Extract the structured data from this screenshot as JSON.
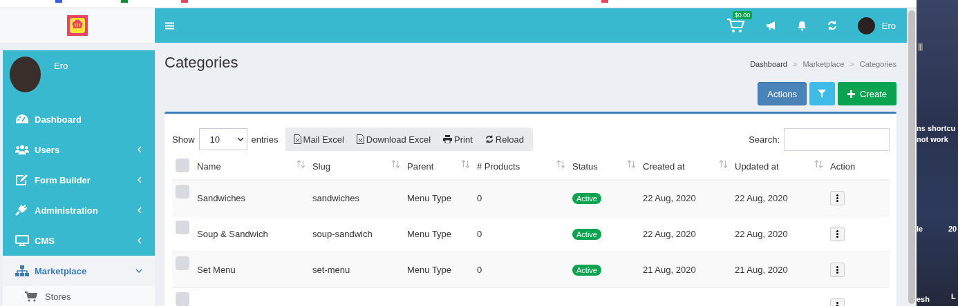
{
  "header": {
    "cart_total": "$0.00",
    "user": "Ero"
  },
  "sidebar": {
    "user": "Ero",
    "items": [
      {
        "label": "Dashboard",
        "expandable": false,
        "expanded": false,
        "selected": false
      },
      {
        "label": "Users",
        "expandable": true,
        "expanded": false,
        "selected": false
      },
      {
        "label": "Form Builder",
        "expandable": true,
        "expanded": false,
        "selected": false
      },
      {
        "label": "Administration",
        "expandable": true,
        "expanded": false,
        "selected": false
      },
      {
        "label": "CMS",
        "expandable": true,
        "expanded": false,
        "selected": false
      },
      {
        "label": "Marketplace",
        "expandable": true,
        "expanded": true,
        "selected": true,
        "children": [
          {
            "label": "Stores",
            "selected": false
          }
        ]
      }
    ]
  },
  "page": {
    "title": "Categories",
    "breadcrumb_separator": ">",
    "breadcrumbs": [
      {
        "label": "Dashboard",
        "link": true
      },
      {
        "label": "Marketplace",
        "link": false
      },
      {
        "label": "Categories",
        "link": false
      }
    ],
    "buttons": [
      {
        "kind": "actions",
        "label": "Actions"
      },
      {
        "kind": "filter"
      },
      {
        "kind": "create",
        "label": "Create"
      }
    ]
  },
  "table": {
    "show_label": "Show",
    "page_size": "10",
    "entries_label": "entries",
    "search_label": "Search:",
    "tools": [
      {
        "kind": "excel",
        "label": "Mail Excel"
      },
      {
        "kind": "excel",
        "label": "Download Excel"
      },
      {
        "kind": "print",
        "label": "Print"
      },
      {
        "kind": "reload",
        "label": "Reload"
      }
    ],
    "select_all_checked": false,
    "columns": [
      {
        "label": "Name",
        "sortable": true
      },
      {
        "label": "Slug",
        "sortable": true
      },
      {
        "label": "Parent",
        "sortable": true
      },
      {
        "label": "# Products",
        "sortable": true
      },
      {
        "label": "Status",
        "sortable": true
      },
      {
        "label": "Created at",
        "sortable": true
      },
      {
        "label": "Updated at",
        "sortable": true
      },
      {
        "label": "Action",
        "sortable": false
      }
    ],
    "rows": [
      {
        "checked": false,
        "name": "Sandwiches",
        "slug": "sandwiches",
        "parent": "Menu Type",
        "products": "0",
        "status": "Active",
        "created": "22 Aug, 2020",
        "updated": "22 Aug, 2020"
      },
      {
        "checked": false,
        "name": "Soup & Sandwich",
        "slug": "soup-sandwich",
        "parent": "Menu Type",
        "products": "0",
        "status": "Active",
        "created": "22 Aug, 2020",
        "updated": "22 Aug, 2020"
      },
      {
        "checked": false,
        "name": "Set Menu",
        "slug": "set-menu",
        "parent": "Menu Type",
        "products": "0",
        "status": "Active",
        "created": "21 Aug, 2020",
        "updated": "21 Aug, 2020"
      },
      {
        "checked": false
      }
    ]
  },
  "desktop": {
    "labels": [
      "t",
      "ns shortcu",
      "not work",
      "le",
      "20",
      "esh",
      "L"
    ]
  }
}
